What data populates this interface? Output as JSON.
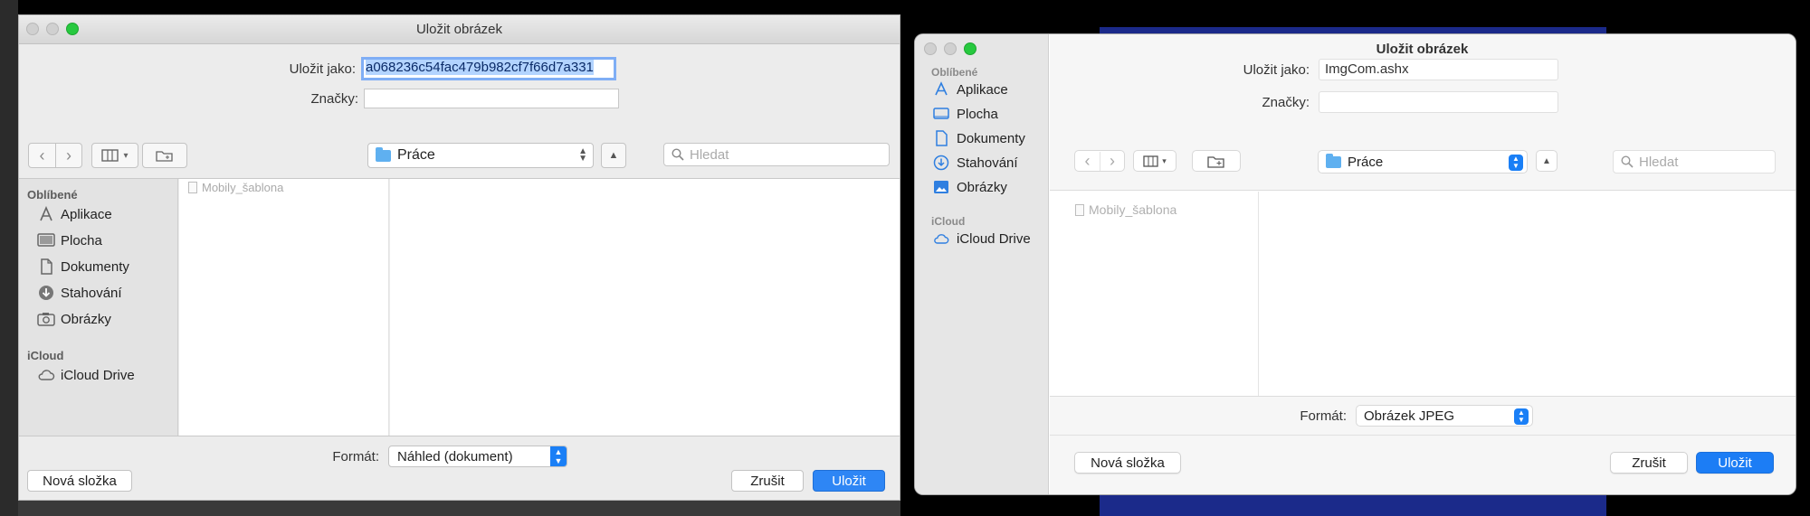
{
  "left_dialog": {
    "title": "Uložit obrázek",
    "save_as_label": "Uložit jako:",
    "save_as_value": "a068236c54fac479b982cf7f66d7a331",
    "tags_label": "Značky:",
    "tags_value": "",
    "location": "Práce",
    "search_placeholder": "Hledat",
    "sidebar": {
      "favorites_header": "Oblíbené",
      "items": [
        "Aplikace",
        "Plocha",
        "Dokumenty",
        "Stahování",
        "Obrázky"
      ],
      "icloud_header": "iCloud",
      "icloud_item": "iCloud Drive"
    },
    "files": [
      "Mobily_šablona"
    ],
    "format_label": "Formát:",
    "format_value": "Náhled (dokument)",
    "new_folder": "Nová složka",
    "cancel": "Zrušit",
    "save": "Uložit"
  },
  "right_dialog": {
    "title": "Uložit obrázek",
    "save_as_label": "Uložit jako:",
    "save_as_value": "ImgCom.ashx",
    "tags_label": "Značky:",
    "tags_value": "",
    "location": "Práce",
    "search_placeholder": "Hledat",
    "sidebar": {
      "favorites_header": "Oblíbené",
      "items": [
        "Aplikace",
        "Plocha",
        "Dokumenty",
        "Stahování",
        "Obrázky"
      ],
      "icloud_header": "iCloud",
      "icloud_item": "iCloud Drive"
    },
    "files": [
      "Mobily_šablona"
    ],
    "format_label": "Formát:",
    "format_value": "Obrázek JPEG",
    "new_folder": "Nová složka",
    "cancel": "Zrušit",
    "save": "Uložit"
  },
  "colors": {
    "accent": "#1a7ff6",
    "traffic_green": "#27c93f",
    "folder_blue": "#5fb0f0"
  }
}
